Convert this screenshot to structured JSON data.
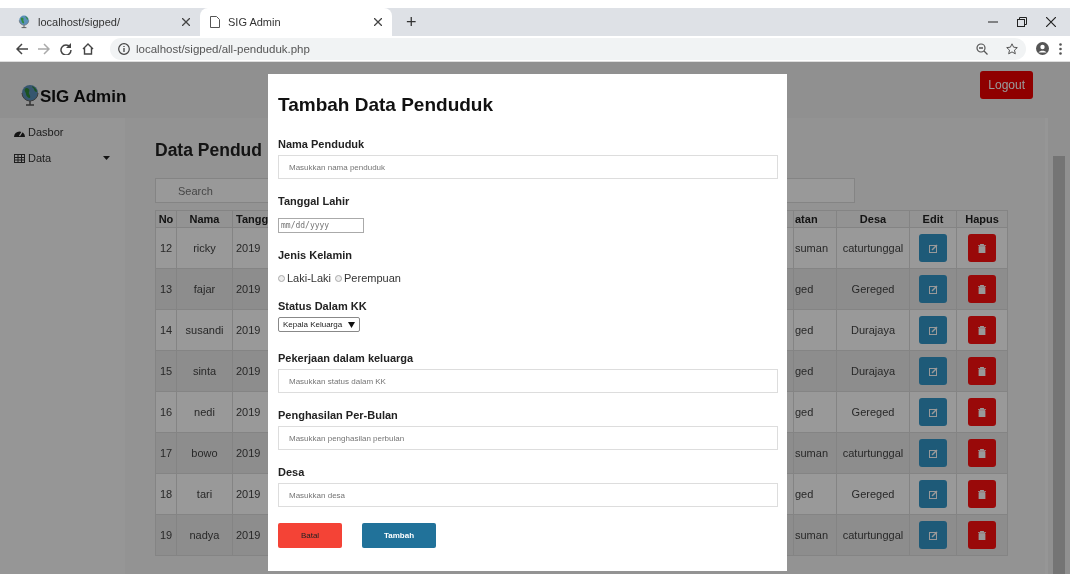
{
  "browser": {
    "tabs": [
      {
        "title": "localhost/sigped/",
        "selected": false
      },
      {
        "title": "SIG Admin",
        "selected": true
      }
    ],
    "new_tab": "+",
    "address": "localhost/sigped/all-penduduk.php"
  },
  "header": {
    "brand": "SIG Admin",
    "logout": "Logout"
  },
  "sidebar": {
    "items": [
      {
        "label": "Dasbor",
        "kind": "dashboard"
      },
      {
        "label": "Data",
        "kind": "dropdown"
      }
    ]
  },
  "content": {
    "title": "Data Pendud",
    "search": {
      "placeholder": "Search"
    },
    "table": {
      "columns": [
        "No",
        "Nama",
        "Tangg",
        "atan",
        "Desa",
        "Edit",
        "Hapus"
      ],
      "rows": [
        {
          "no": "12",
          "nama": "ricky",
          "column_3": "2019",
          "column_4": "suman",
          "desa": "caturtunggal"
        },
        {
          "no": "13",
          "nama": "fajar",
          "column_3": "2019",
          "column_4": "ged",
          "desa": "Gereged"
        },
        {
          "no": "14",
          "nama": "susandi",
          "column_3": "2019",
          "column_4": "ged",
          "desa": "Durajaya"
        },
        {
          "no": "15",
          "nama": "sinta",
          "column_3": "2019",
          "column_4": "ged",
          "desa": "Durajaya"
        },
        {
          "no": "16",
          "nama": "nedi",
          "column_3": "2019",
          "column_4": "ged",
          "desa": "Gereged"
        },
        {
          "no": "17",
          "nama": "bowo",
          "column_3": "2019",
          "column_4": "suman",
          "desa": "caturtunggal"
        },
        {
          "no": "18",
          "nama": "tari",
          "column_3": "2019",
          "column_4": "ged",
          "desa": "Gereged"
        },
        {
          "no": "19",
          "nama": "nadya",
          "column_3": "2019",
          "column_4": "suman",
          "desa": "caturtunggal"
        }
      ]
    }
  },
  "modal": {
    "title": "Tambah Data Penduduk",
    "fields": [
      {
        "kind": "text",
        "label": "Nama Penduduk",
        "placeholder": "Masukkan nama penduduk"
      },
      {
        "kind": "date",
        "label": "Tanggal Lahir",
        "placeholder": "mm/dd/yyyy"
      },
      {
        "kind": "radio",
        "label": "Jenis Kelamin",
        "options": [
          {
            "label": "Laki-Laki",
            "selected": false
          },
          {
            "label": "Perempuan",
            "selected": false
          }
        ]
      },
      {
        "kind": "select",
        "label": "Status Dalam KK",
        "value": "Kepala Keluarga"
      },
      {
        "kind": "text",
        "label": "Pekerjaan dalam keluarga",
        "placeholder": "Masukkan status dalam KK"
      },
      {
        "kind": "text",
        "label": "Penghasilan Per-Bulan",
        "placeholder": "Masukkan penghasilan perbulan"
      },
      {
        "kind": "text",
        "label": "Desa",
        "placeholder": "Masukkan desa"
      }
    ],
    "buttons": [
      {
        "label": "Batal",
        "kind": "cancel"
      },
      {
        "label": "Tambah",
        "kind": "submit"
      }
    ]
  }
}
